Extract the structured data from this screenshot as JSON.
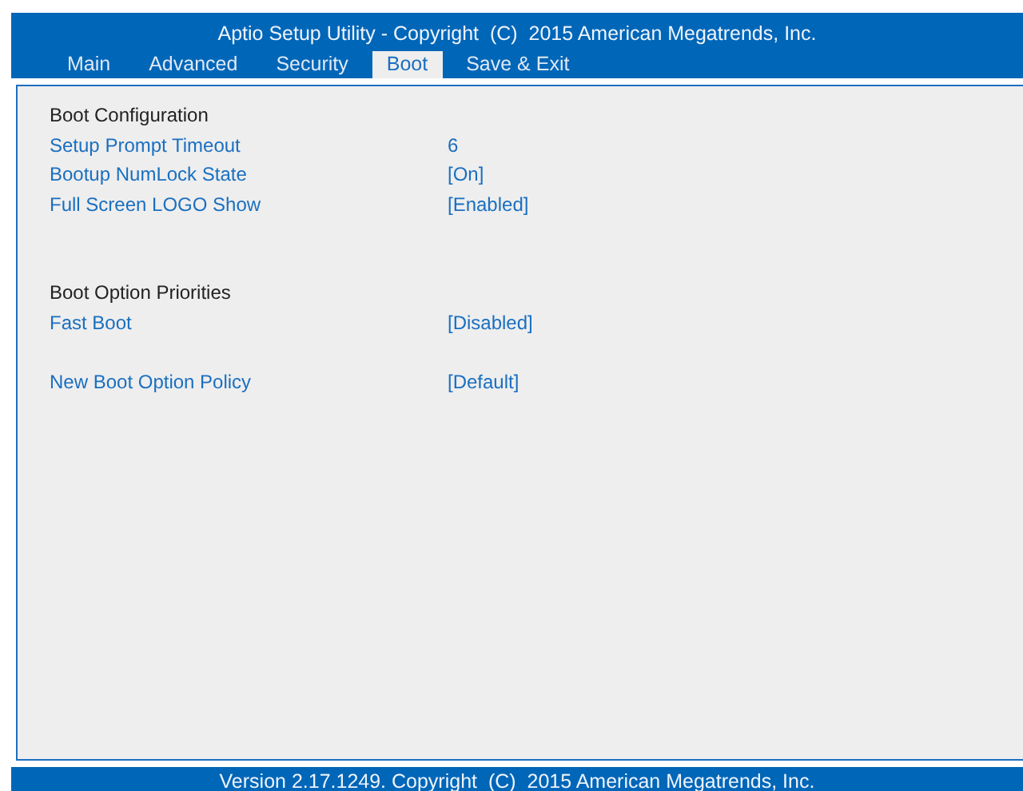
{
  "header": {
    "title": "Aptio Setup Utility - Copyright  (C)  2015 American Megatrends, Inc."
  },
  "tabs": [
    {
      "label": "Main",
      "selected": false
    },
    {
      "label": "Advanced",
      "selected": false
    },
    {
      "label": "Security",
      "selected": false
    },
    {
      "label": "Boot",
      "selected": true
    },
    {
      "label": "Save & Exit",
      "selected": false
    }
  ],
  "sections": [
    {
      "title": "Boot Configuration",
      "settings": [
        {
          "label": "Setup Prompt Timeout",
          "value": "6"
        },
        {
          "label": "Bootup NumLock State",
          "value": "[On]"
        },
        {
          "label": "Full Screen LOGO Show",
          "value": "[Enabled]"
        }
      ]
    },
    {
      "title": "Boot Option Priorities",
      "settings": [
        {
          "label": "Fast Boot",
          "value": "[Disabled]"
        }
      ]
    },
    {
      "settings": [
        {
          "label": "New Boot Option Policy",
          "value": "[Default]"
        }
      ]
    }
  ],
  "footer": {
    "text": "Version 2.17.1249. Copyright  (C)  2015 American Megatrends, Inc."
  }
}
